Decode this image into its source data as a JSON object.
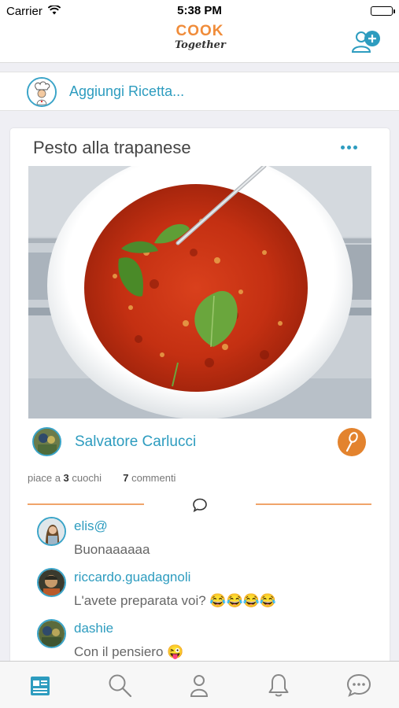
{
  "status_bar": {
    "carrier": "Carrier",
    "time": "5:38 PM"
  },
  "nav": {
    "logo_top": "COOK",
    "logo_bottom": "Together",
    "add_user_icon": "add-user-icon"
  },
  "composer": {
    "label": "Aggiungi Ricetta..."
  },
  "post": {
    "title": "Pesto alla trapanese",
    "author": "Salvatore Carlucci",
    "likes_prefix": "piace a",
    "likes_count": "3",
    "likes_suffix": "cuochi",
    "comments_count": "7",
    "comments_suffix": "commenti"
  },
  "comments": [
    {
      "user": "elis@",
      "text": "Buonaaaaaa"
    },
    {
      "user": "riccardo.guadagnoli",
      "text": "L'avete preparata voi? 😂😂😂😂"
    },
    {
      "user": "dashie",
      "text": "Con il pensiero 😜"
    }
  ],
  "tabs": [
    {
      "icon": "feed-icon",
      "active": true
    },
    {
      "icon": "search-icon",
      "active": false
    },
    {
      "icon": "profile-icon",
      "active": false
    },
    {
      "icon": "bell-icon",
      "active": false
    },
    {
      "icon": "chat-icon",
      "active": false
    }
  ],
  "colors": {
    "accent": "#2d9cbf",
    "orange": "#e3832e",
    "divider": "#f0a46a"
  }
}
